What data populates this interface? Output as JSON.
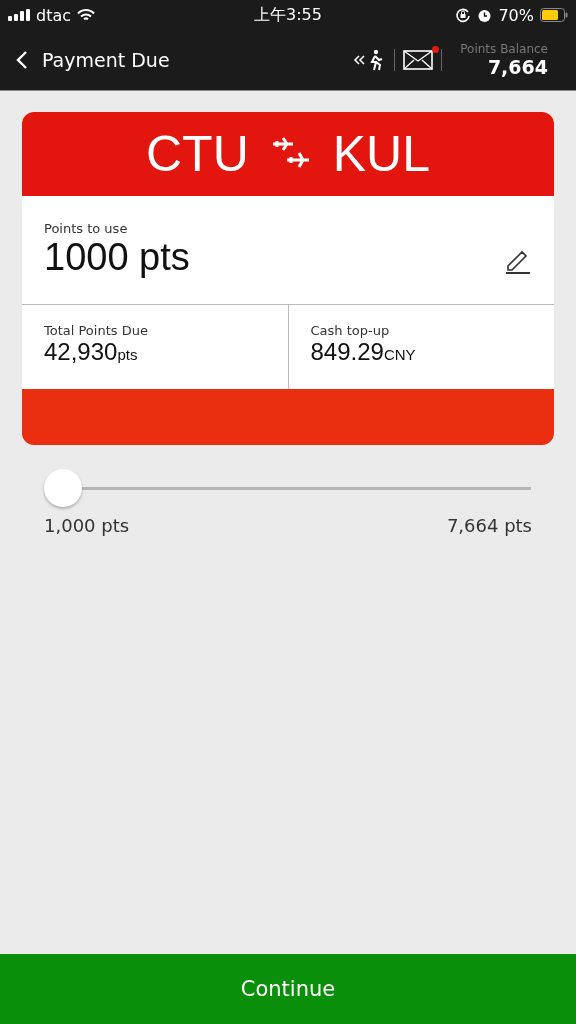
{
  "status_bar": {
    "carrier": "dtac",
    "time": "上午3:55",
    "battery": "70%"
  },
  "header": {
    "title": "Payment Due",
    "has_unread_mail": true,
    "points_balance_label": "Points Balance",
    "points_balance": "7,664"
  },
  "route": {
    "origin": "CTU",
    "destination": "KUL"
  },
  "points_to_use": {
    "label": "Points to use",
    "value": "1000 pts"
  },
  "summary": [
    {
      "label": "Total Points Due",
      "value": "42,930",
      "unit": "pts"
    },
    {
      "label": "Cash top-up",
      "value": "849.29",
      "unit": "CNY"
    }
  ],
  "slider": {
    "level": 0,
    "min_label": "1,000 pts",
    "max_label": "7,664 pts"
  },
  "footer": {
    "button": "Continue"
  }
}
